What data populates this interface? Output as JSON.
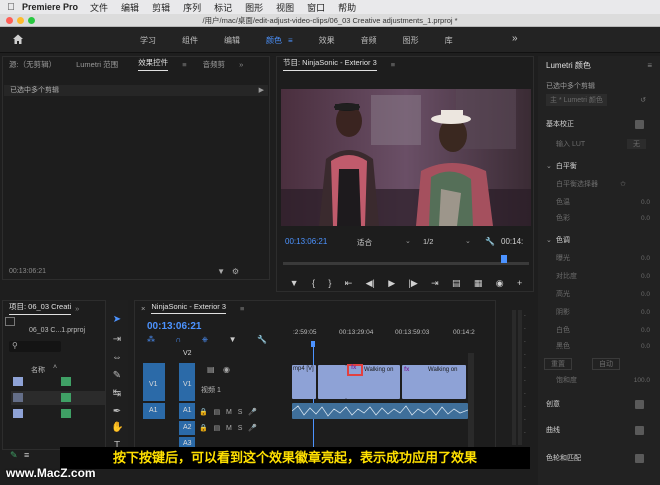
{
  "menubar": {
    "app_name": "Premiere Pro",
    "items": [
      "文件",
      "编辑",
      "剪辑",
      "序列",
      "标记",
      "图形",
      "视图",
      "窗口",
      "帮助"
    ]
  },
  "window": {
    "title": "/用户/mac/桌面/edit-adjust-video-clips/06_03 Creative adjustments_1.prproj *"
  },
  "workspace": {
    "tabs": [
      "学习",
      "组件",
      "编辑",
      "颜色",
      "效果",
      "音频",
      "图形",
      "库"
    ],
    "active": "颜色",
    "more": "»"
  },
  "source_panel": {
    "tabs": [
      "源:（无剪辑）",
      "Lumetri 范围",
      "效果控件",
      "音频剪"
    ],
    "active": "效果控件",
    "selection_text": "已选中多个剪辑",
    "timecode": "00:13:06:21"
  },
  "program_monitor": {
    "title": "节目: NinjaSonic - Exterior 3",
    "timecode": "00:13:06:21",
    "fit": "适合",
    "resolution": "1/2",
    "end_timecode": "00:14:"
  },
  "lumetri": {
    "title": "Lumetri 颜色",
    "selection": "已选中多个剪辑",
    "preset_label": "主 * Lumetri 颜色",
    "basic": "基本校正",
    "input_lut_label": "输入 LUT",
    "input_lut_value": "无",
    "white_balance": "白平衡",
    "wb_selector": "白平衡选择器",
    "temp": "色温",
    "tint": "色彩",
    "tone": "色调",
    "tone_items": [
      "曝光",
      "对比度",
      "高光",
      "阴影",
      "白色",
      "黑色"
    ],
    "reset": "重置",
    "auto": "自动",
    "saturation": "饱和度",
    "saturation_value": "100.0",
    "zero": "0.0",
    "sections": [
      "创意",
      "曲线",
      "色轮和匹配"
    ]
  },
  "project_panel": {
    "title": "项目: 06_03 Creati",
    "file": "06_03 C...1.prproj",
    "column": "名称"
  },
  "timeline": {
    "sequence": "NinjaSonic - Exterior 3",
    "timecode": "00:13:06:21",
    "ruler": [
      ":2:59:05",
      "00:13:29:04",
      "00:13:59:03",
      "00:14:2"
    ],
    "tracks": {
      "v2": "V2",
      "v1": "V1",
      "v1_name": "视频 1",
      "a1": "A1",
      "a2": "A2",
      "a3": "A3"
    },
    "clips": [
      "mp4 [V]",
      "Walking on",
      "Walking on"
    ],
    "fx_label": "fx"
  },
  "caption": "按下按键后，可以看到这个效果徽章亮起，表示成功应用了效果",
  "watermark": "www.MacZ.com",
  "colors": {
    "accent": "#4c93ff",
    "clip_video": "#8ea2d6",
    "clip_audio": "#3f6f9a",
    "track_blue": "#2b6aa8",
    "highlight": "#e24040",
    "caption_text": "#ffe000"
  }
}
